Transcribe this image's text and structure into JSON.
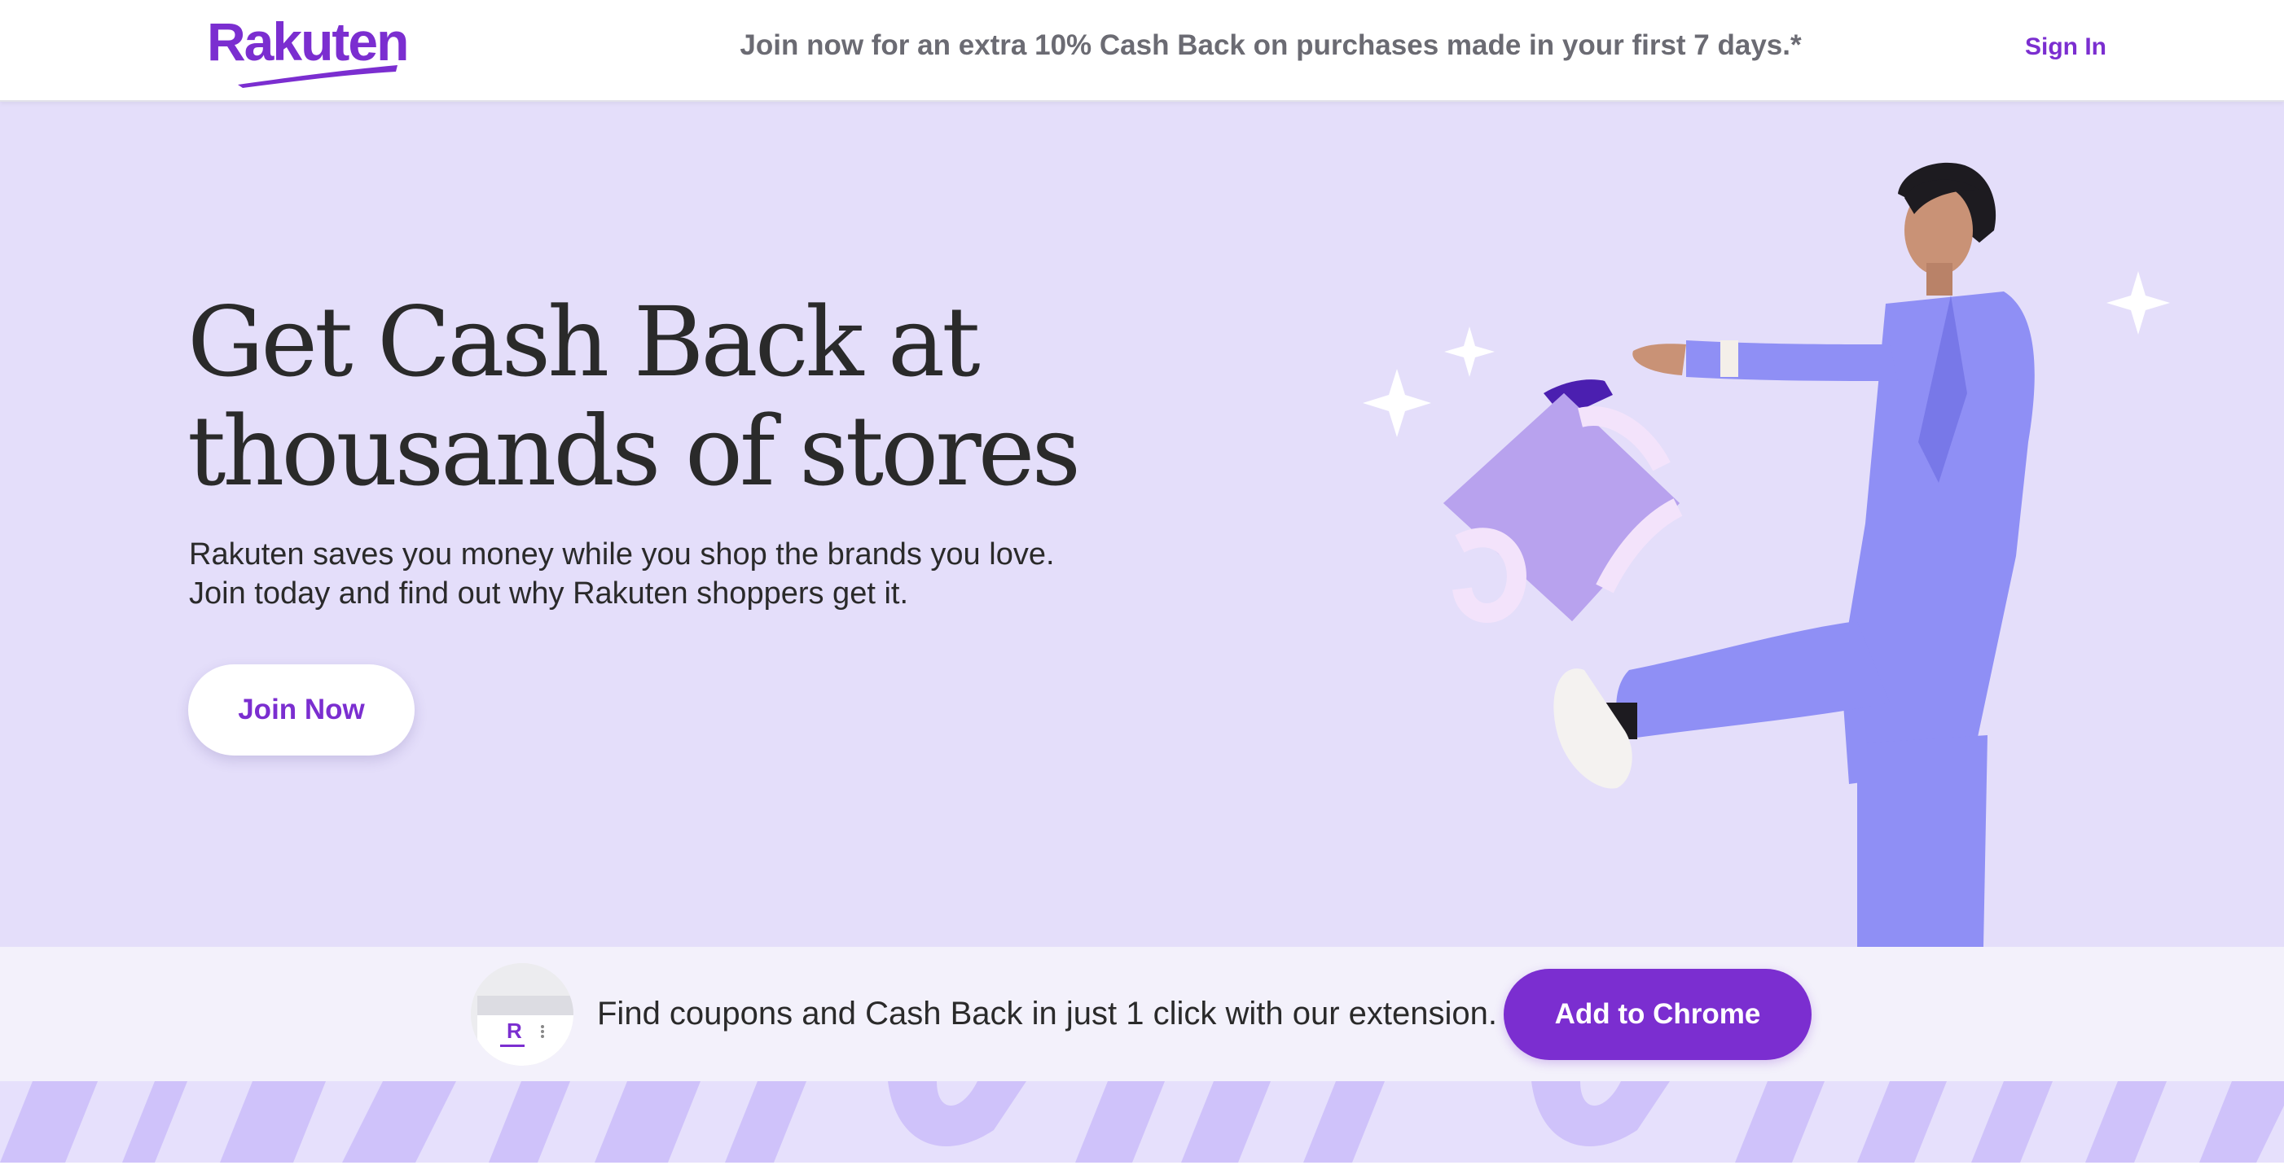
{
  "header": {
    "logo_text": "Rakuten",
    "promo_text": "Join now for an extra 10% Cash Back on purchases made in your first 7 days.*",
    "signin_label": "Sign In"
  },
  "hero": {
    "title_line1": "Get Cash Back at",
    "title_line2": "thousands of stores",
    "subtitle_line1": "Rakuten saves you money while you shop the brands you love.",
    "subtitle_line2": "Join today and find out why Rakuten shoppers get it.",
    "join_label": "Join Now"
  },
  "extension_bar": {
    "thumb_letter": "R",
    "text": "Find coupons and Cash Back in just 1 click with our extension.",
    "button_label": "Add to Chrome"
  },
  "colors": {
    "brand_purple": "#7b2ed0",
    "hero_bg": "#e4defa",
    "suit_blue": "#8f8ff5",
    "bag_lilac": "#b8a2ee"
  },
  "icons": [
    "rakuten-logo",
    "sparkle-icon",
    "shopping-bag-illustration",
    "extension-thumbnail"
  ]
}
